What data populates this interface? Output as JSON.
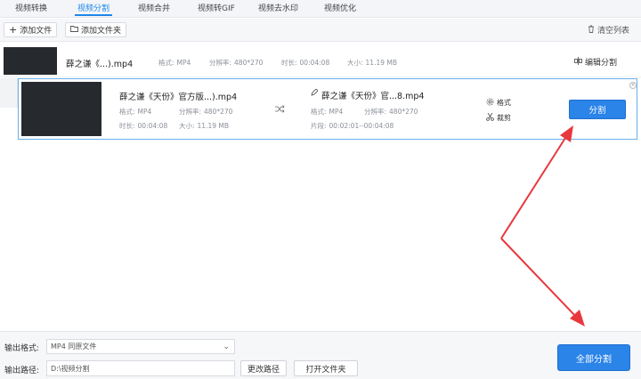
{
  "tabs": [
    {
      "label": "视频转换"
    },
    {
      "label": "视频分割"
    },
    {
      "label": "视频合并"
    },
    {
      "label": "视频转GIF"
    },
    {
      "label": "视频去水印"
    },
    {
      "label": "视频优化"
    }
  ],
  "toolbar": {
    "add_file": "添加文件",
    "add_folder": "添加文件夹",
    "clear_list": "清空列表"
  },
  "file1": {
    "name": "薛之谦《...).mp4",
    "format_label": "格式:",
    "format": "MP4",
    "res_label": "分辨率:",
    "res": "480*270",
    "dur_label": "时长:",
    "dur": "00:04:08",
    "size_label": "大小:",
    "size": "11.19 MB",
    "edit_label": "编辑分割"
  },
  "file2": {
    "src_name": "薛之谦《天份》官方版...).mp4",
    "format_label": "格式:",
    "format": "MP4",
    "res_label": "分辨率:",
    "res": "480*270",
    "dur_label": "时长:",
    "dur": "00:04:08",
    "size_label": "大小:",
    "size": "11.19 MB",
    "out_name": "薛之谦《天份》官...8.mp4",
    "out_format_label": "格式:",
    "out_format": "MP4",
    "out_res_label": "分辨率:",
    "out_res": "480*270",
    "range_label": "片段:",
    "range": "00:02:01--00:04:08",
    "opt_format": "格式",
    "opt_cut": "裁剪",
    "split_label": "分割"
  },
  "bottom": {
    "format_label": "输出格式:",
    "format_value": "MP4  同原文件",
    "path_label": "输出路径:",
    "path_value": "D:\\视频分割",
    "change_path": "更改路径",
    "open_folder": "打开文件夹",
    "split_all": "全部分割"
  },
  "colors": {
    "accent": "#2b84e8",
    "arrow": "#e8383d",
    "selected_border": "#6aaeea"
  }
}
